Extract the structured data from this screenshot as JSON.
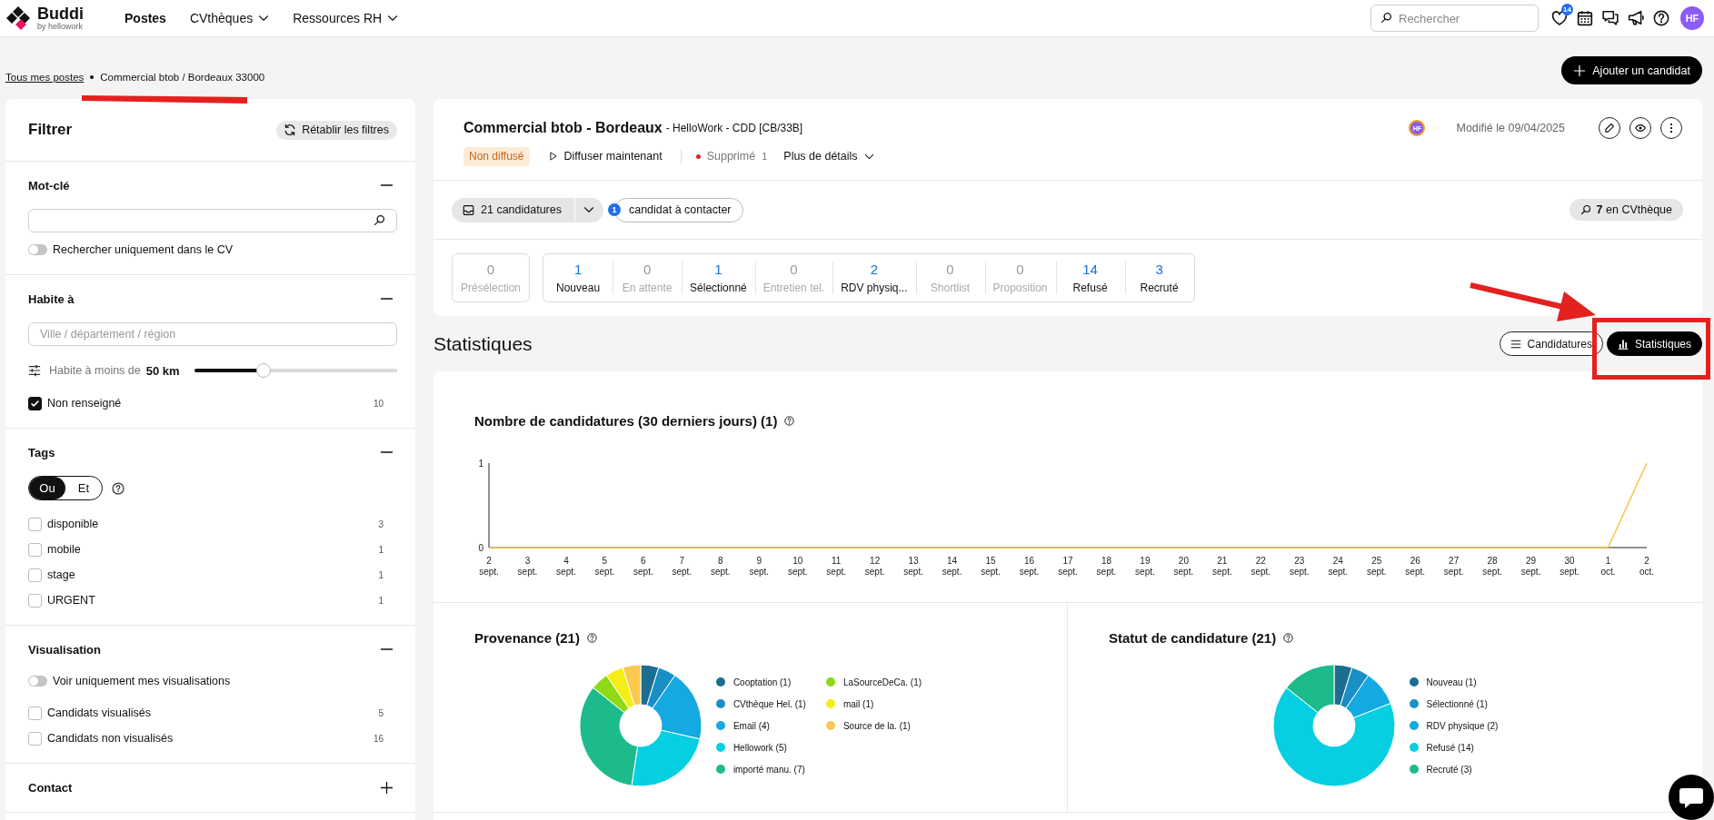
{
  "header": {
    "logo": {
      "name": "Buddi",
      "tagline": "by hellowork"
    },
    "nav": [
      {
        "label": "Postes",
        "selected": true,
        "dropdown": false
      },
      {
        "label": "CVthèques",
        "selected": false,
        "dropdown": true
      },
      {
        "label": "Ressources RH",
        "selected": false,
        "dropdown": true
      }
    ],
    "search": {
      "placeholder": "Rechercher"
    },
    "favorites_badge": "14",
    "avatar": "HF"
  },
  "breadcrumb": [
    {
      "label": "Tous mes postes",
      "link": true
    },
    {
      "label": "Commercial btob / Bordeaux 33000",
      "link": false
    }
  ],
  "add_candidate_button": "Ajouter un candidat",
  "annotations": [
    {
      "kind": "underline"
    },
    {
      "kind": "arrow"
    },
    {
      "kind": "frame"
    }
  ],
  "filters": {
    "title": "Filtrer",
    "reset_button": "Rétablir les filtres",
    "sections": [
      {
        "title": "Mot-clé",
        "expanded": true,
        "items": [
          {
            "kind": "search"
          },
          {
            "kind": "toggle",
            "label": "Rechercher uniquement dans le CV",
            "on": false
          }
        ]
      },
      {
        "title": "Habite à",
        "expanded": true,
        "items": [
          {
            "kind": "field",
            "placeholder": "Ville / département / région"
          },
          {
            "kind": "slider",
            "label": "Habite à moins de",
            "value": "50 km",
            "level": 0.34
          },
          {
            "kind": "checkbox",
            "label": "Non renseigné",
            "count": "10",
            "checked": true
          }
        ]
      },
      {
        "title": "Tags",
        "expanded": true,
        "items": [
          {
            "kind": "segmented",
            "options": [
              {
                "label": "Ou",
                "selected": true
              },
              {
                "label": "Et",
                "selected": false
              }
            ]
          },
          {
            "kind": "checkbox",
            "label": "disponible",
            "count": "3",
            "checked": false
          },
          {
            "kind": "checkbox",
            "label": "mobile",
            "count": "1",
            "checked": false
          },
          {
            "kind": "checkbox",
            "label": "stage",
            "count": "1",
            "checked": false
          },
          {
            "kind": "checkbox",
            "label": "URGENT",
            "count": "1",
            "checked": false
          }
        ]
      },
      {
        "title": "Visualisation",
        "expanded": true,
        "items": [
          {
            "kind": "toggle",
            "label": "Voir uniquement mes visualisations",
            "on": false
          },
          {
            "kind": "checkbox",
            "label": "Candidats visualisés",
            "count": "5",
            "checked": false
          },
          {
            "kind": "checkbox",
            "label": "Candidats non visualisés",
            "count": "16",
            "checked": false
          }
        ]
      },
      {
        "title": "Contact",
        "expanded": false
      }
    ]
  },
  "job": {
    "title": "Commercial btob - Bordeaux",
    "subtitle": "- HelloWork - CDD [CB/33B]",
    "owner": "HF",
    "modified": "Modifié le 09/04/2025",
    "status": "Non diffusé",
    "publish_button": "Diffuser maintenant",
    "deleted_label": "Supprimé",
    "deleted_count": "1",
    "details_button": "Plus de détails",
    "applications_button": "21 candidatures",
    "to_contact_count": "1",
    "to_contact_button": "candidat à contacter",
    "cvtheque_button": "**7** en CVthèque"
  },
  "pipeline": {
    "preselection": {
      "count": "0",
      "label": "Présélection",
      "disabled": true
    },
    "stages": [
      {
        "count": "1",
        "label": "Nouveau",
        "disabled": false
      },
      {
        "count": "0",
        "label": "En attente",
        "disabled": true
      },
      {
        "count": "1",
        "label": "Sélectionné",
        "disabled": false
      },
      {
        "count": "0",
        "label": "Entretien tel.",
        "disabled": true
      },
      {
        "count": "2",
        "label": "RDV physiq...",
        "disabled": false
      },
      {
        "count": "0",
        "label": "Shortlist",
        "disabled": true
      },
      {
        "count": "0",
        "label": "Proposition",
        "disabled": true
      },
      {
        "count": "14",
        "label": "Refusé",
        "disabled": false
      },
      {
        "count": "3",
        "label": "Recruté",
        "disabled": false
      }
    ]
  },
  "statistics": {
    "title": "Statistiques",
    "views": [
      {
        "label": "Candidatures",
        "selected": false
      },
      {
        "label": "Statistiques",
        "selected": true
      }
    ],
    "line_chart": {
      "chart_data": {
        "type": "line",
        "title": "Nombre de candidatures (30 derniers jours) (1)",
        "categories": [
          "2 sept.",
          "3 sept.",
          "4 sept.",
          "5 sept.",
          "6 sept.",
          "7 sept.",
          "8 sept.",
          "9 sept.",
          "10 sept.",
          "11 sept.",
          "12 sept.",
          "13 sept.",
          "14 sept.",
          "15 sept.",
          "16 sept.",
          "17 sept.",
          "18 sept.",
          "19 sept.",
          "20 sept.",
          "21 sept.",
          "22 sept.",
          "23 sept.",
          "24 sept.",
          "25 sept.",
          "26 sept.",
          "27 sept.",
          "28 sept.",
          "29 sept.",
          "30 sept.",
          "1 oct.",
          "2 oct."
        ],
        "series": [
          {
            "color": "#f7c548",
            "values": [
              0,
              0,
              0,
              0,
              0,
              0,
              0,
              0,
              0,
              0,
              0,
              0,
              0,
              0,
              0,
              0,
              0,
              0,
              0,
              0,
              0,
              0,
              0,
              0,
              0,
              0,
              0,
              0,
              0,
              0,
              1
            ]
          }
        ],
        "ylim": [
          0,
          1
        ],
        "yticks": [
          0,
          1
        ]
      }
    },
    "donuts": [
      {
        "chart_data": {
          "type": "donut",
          "title": "Provenance (21)",
          "categories": [
            "Cooptation (1)",
            "CVthèque Hel. (1)",
            "Email (4)",
            "Hellowork (5)",
            "importé manu. (7)",
            "LaSourceDeCa. (1)",
            "mail (1)",
            "Source de la. (1)"
          ],
          "values": [
            1,
            1,
            4,
            5,
            7,
            1,
            1,
            1
          ],
          "colors": [
            "#1c6e91",
            "#1a8fc6",
            "#14a9e1",
            "#05cfe0",
            "#1dbb8b",
            "#8fd919",
            "#f5ee16",
            "#fbc94f"
          ],
          "legend": "right"
        }
      },
      {
        "chart_data": {
          "type": "donut",
          "title": "Statut de candidature (21)",
          "categories": [
            "Nouveau (1)",
            "Sélectionné (1)",
            "RDV physique (2)",
            "Refusé (14)",
            "Recruté (3)"
          ],
          "values": [
            1,
            1,
            2,
            14,
            3
          ],
          "colors": [
            "#1c6e91",
            "#1a8fc6",
            "#14a9e1",
            "#05cfe0",
            "#1dbb8b"
          ],
          "legend": "right"
        }
      }
    ]
  }
}
